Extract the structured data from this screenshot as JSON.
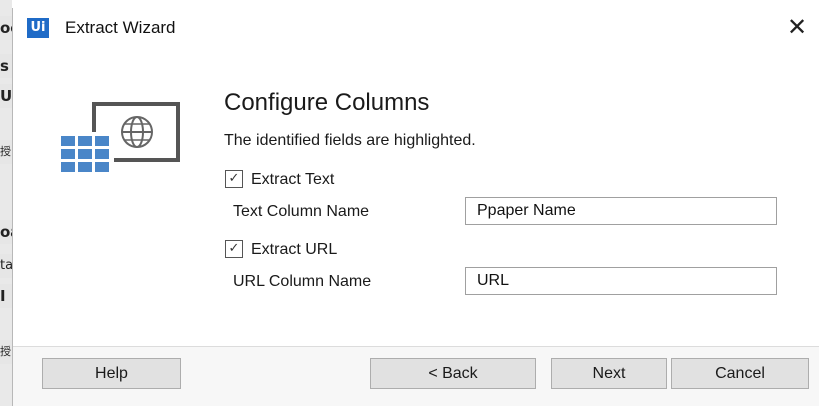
{
  "window": {
    "app_icon_label": "Ui",
    "title": "Extract Wizard",
    "close_glyph": "✕"
  },
  "background_fragments": [
    "oc",
    "s",
    "U",
    "授",
    "oa",
    "ta",
    "I",
    "授"
  ],
  "main": {
    "heading": "Configure Columns",
    "description": "The identified fields are highlighted.",
    "icon": "table-globe-icon",
    "extract_text": {
      "label": "Extract Text",
      "checked": true,
      "column_label": "Text Column Name",
      "column_value": "Ppaper Name"
    },
    "extract_url": {
      "label": "Extract URL",
      "checked": true,
      "column_label": "URL Column Name",
      "column_value": "URL"
    }
  },
  "footer": {
    "help": "Help",
    "back": "< Back",
    "next": "Next",
    "cancel": "Cancel"
  },
  "colors": {
    "accent": "#1f6bc7",
    "icon_table": "#4a86c8",
    "button_bg": "#e1e1e1"
  }
}
